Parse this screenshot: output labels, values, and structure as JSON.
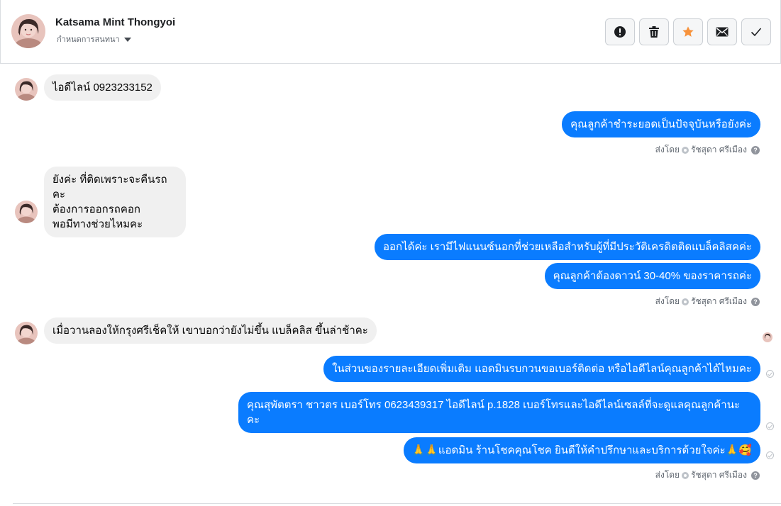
{
  "header": {
    "name": "Katsama Mint Thongyoi",
    "subtitle": "กำหนดการสนทนา",
    "actions": [
      {
        "icon": "alert-icon",
        "label": "Mark as spam"
      },
      {
        "icon": "trash-icon",
        "label": "Delete"
      },
      {
        "icon": "star-icon",
        "label": "Star"
      },
      {
        "icon": "mail-icon",
        "label": "Mark as unread"
      },
      {
        "icon": "check-icon",
        "label": "Mark as done"
      }
    ]
  },
  "messages": {
    "m1": "ไอดีไลน์ 0923233152",
    "m2": "คุณลูกค้าชำระยอดเป็นปัจจุบันหรือยังค่ะ",
    "m3": "ยังค่ะ ที่ติดเพราะจะคืนรถคะ\nต้องการออกรถคอก\nพอมีทางช่วยไหมคะ",
    "m4": "ออกได้ค่ะ เรามีไฟแนนซ์นอกที่ช่วยเหลือสำหรับผู้ที่มีประวัติเครดิตติดแบล็คลิสคค่ะ",
    "m5": "คุณลูกค้าต้องดาวน์ 30-40% ของราคารถค่ะ",
    "m6": "เมื่อวานลองให้กรุงศรีเช็คให้ เขาบอกว่ายังไม่ขึ้น แบล็คลิส ขึ้นล่าช้าคะ",
    "m7": "ในส่วนของรายละเอียดเพิ่มเติม แอดมินรบกวนขอเบอร์ติดต่อ หรือไอดีไลน์คุณลูกค้าได้ไหมคะ",
    "m8": "คุณสุพัตตรา   ชาวตร     เบอร์โทร 0623439317  ไอดีไลน์ p.1828   เบอร์โทรและไอดีไลน์เซลล์ที่จะดูแลคุณลูกค้านะคะ",
    "m9": "🙏🙏แอดมิน ร้านโชคคุณโชค ยินดีให้คำปรึกษาและบริการด้วยใจค่ะ🙏🥰"
  },
  "sent_by": {
    "prefix": "ส่งโดย",
    "agent": "รัชสุดา ศรีเมือง",
    "help": "?"
  },
  "colors": {
    "outgoing": "#0a7cff",
    "incoming": "#f0f0f0",
    "star": "#f7923b"
  }
}
